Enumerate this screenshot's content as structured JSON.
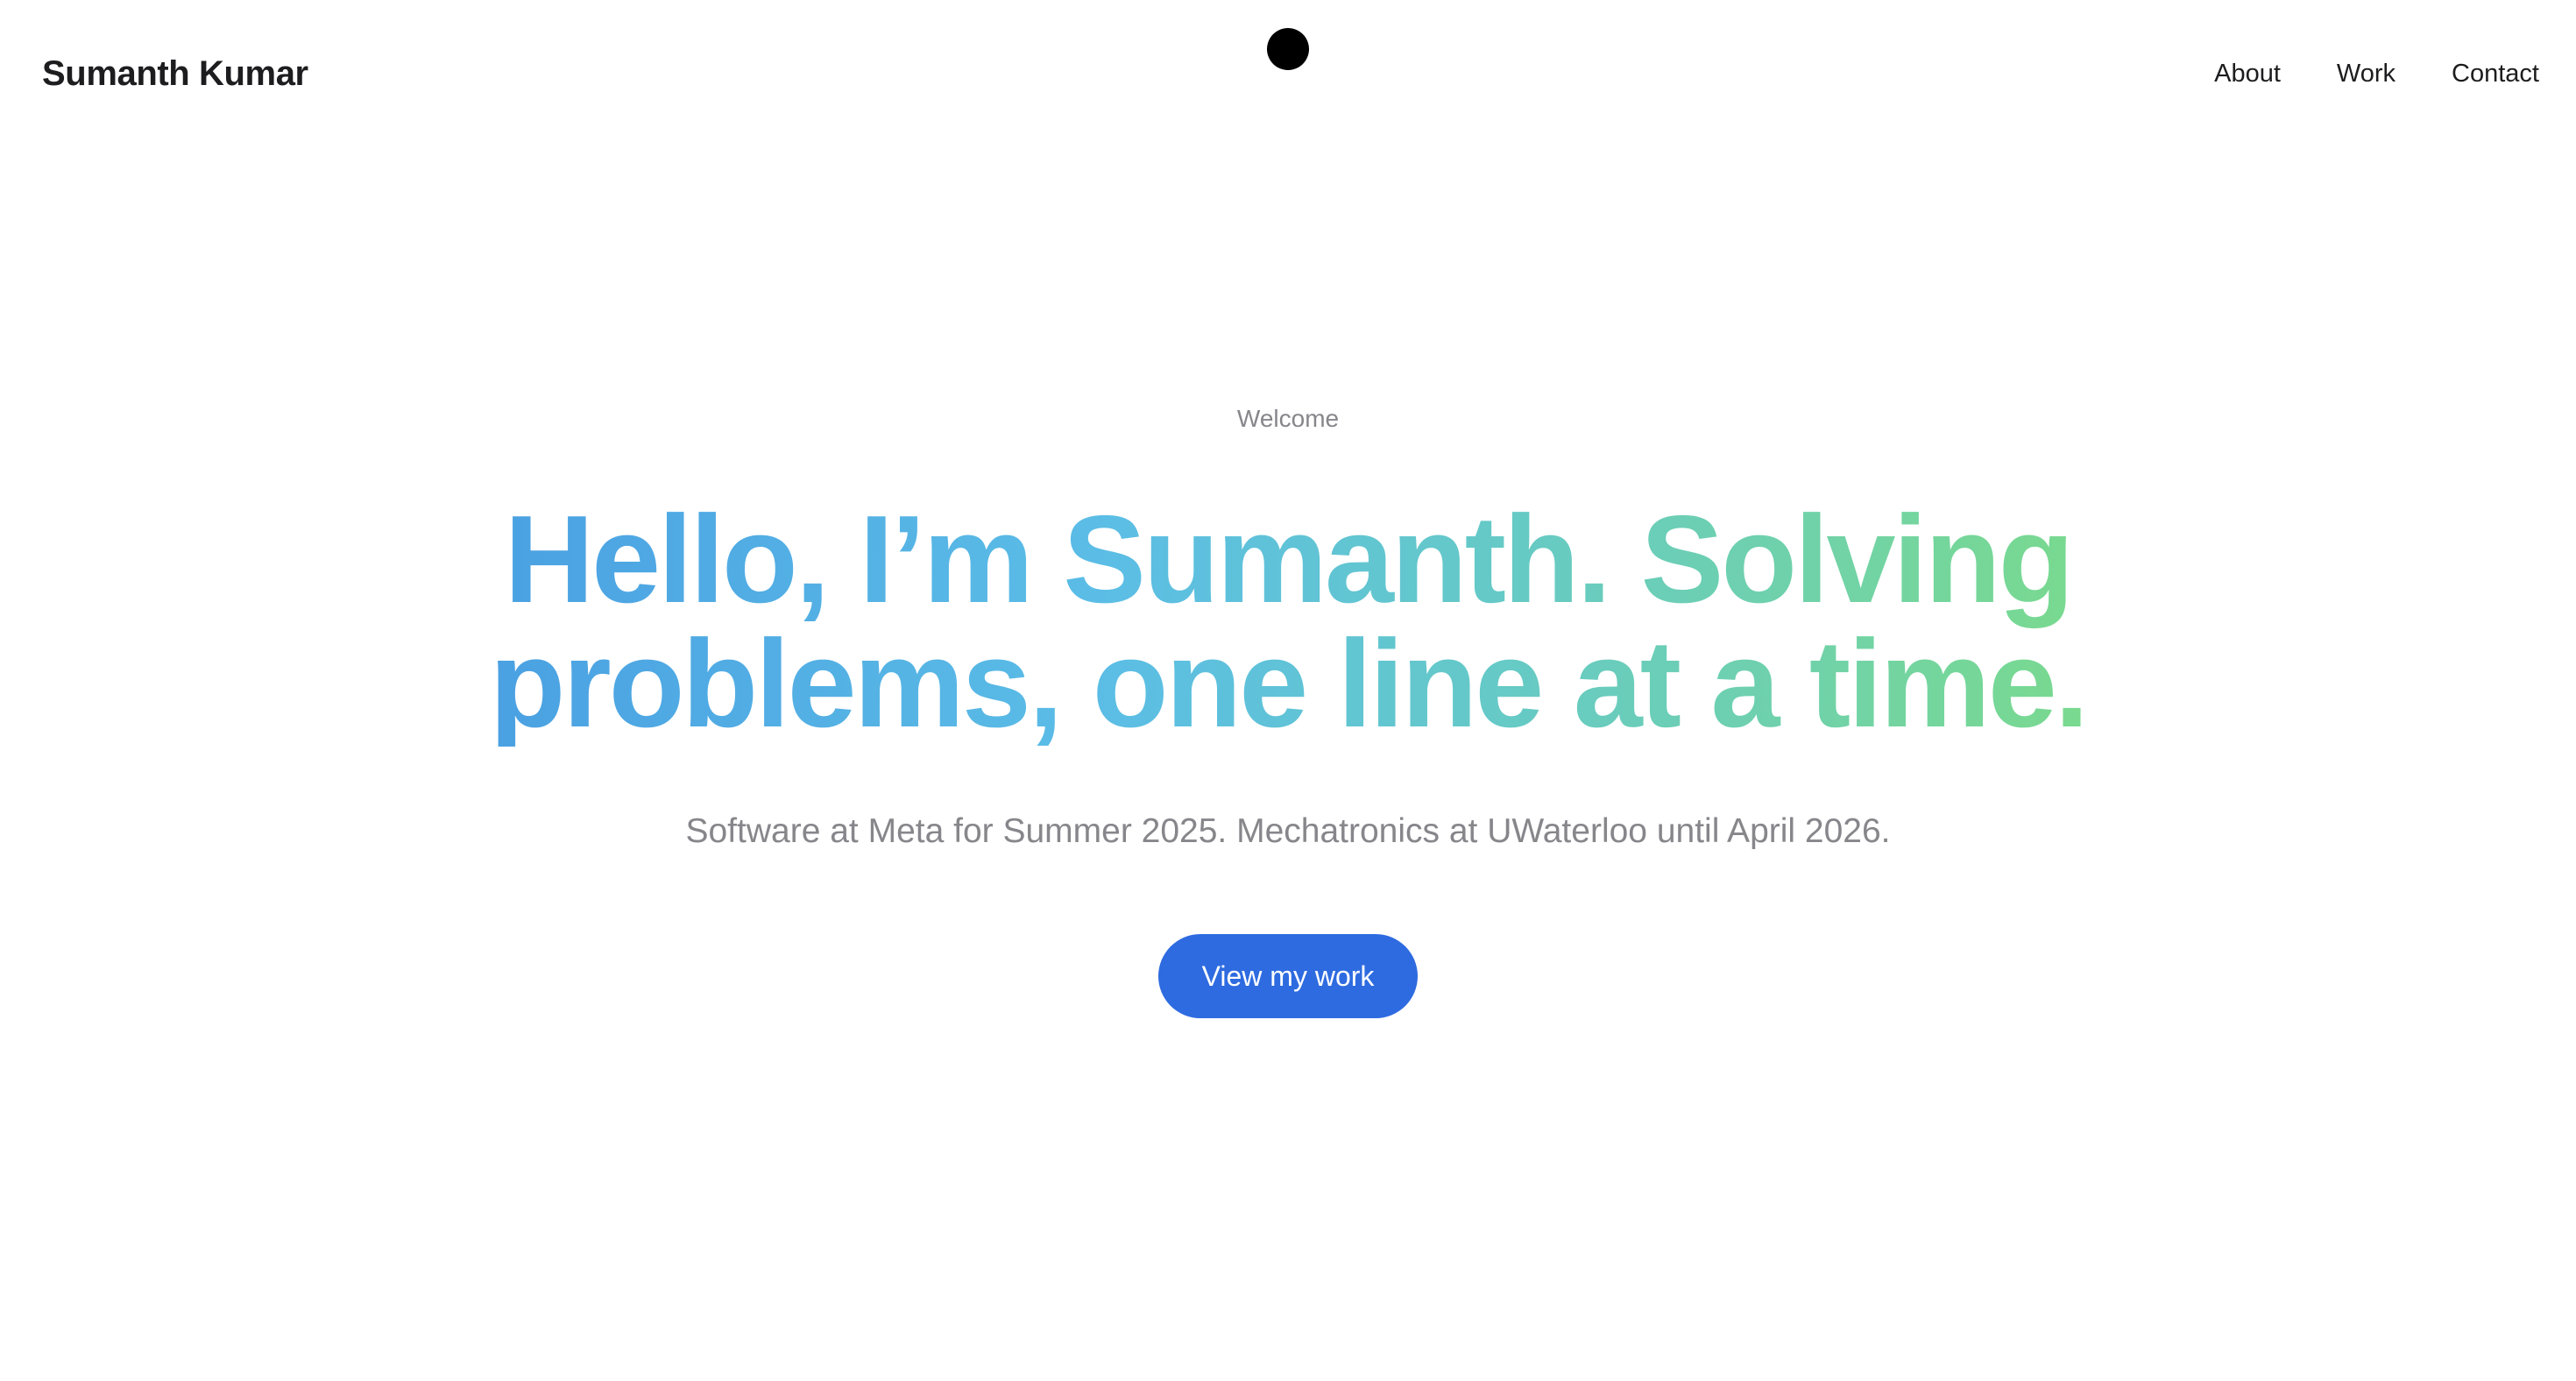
{
  "header": {
    "brand_name": "Sumanth Kumar",
    "logo_icon": "black-circle-logo",
    "nav": [
      {
        "label": "About"
      },
      {
        "label": "Work"
      },
      {
        "label": "Contact"
      }
    ]
  },
  "hero": {
    "eyebrow": "Welcome",
    "headline": "Hello, I’m Sumanth. Solving problems, one line at a time.",
    "subtitle": "Software at Meta for Summer 2025. Mechatronics at UWaterloo until April 2026.",
    "cta_label": "View my work"
  },
  "colors": {
    "gradient_start": "#4aa0e2",
    "gradient_mid": "#5bbde6",
    "gradient_end": "#7ada8d",
    "cta_background": "#2e6be0",
    "muted_text": "#86868b",
    "text": "#1d1d1f"
  }
}
